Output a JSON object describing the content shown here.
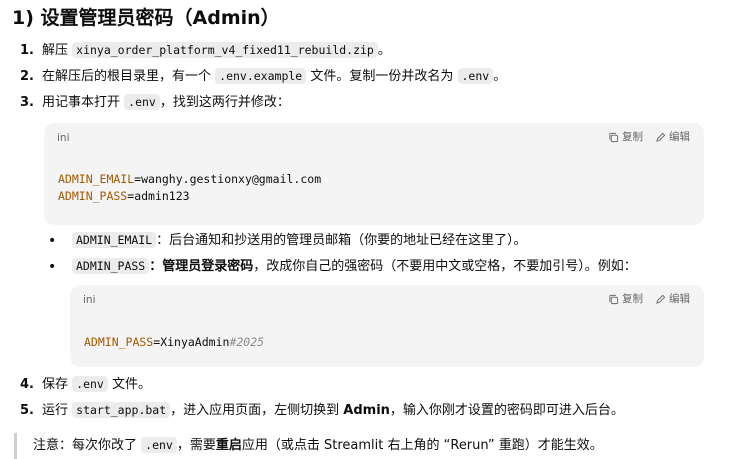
{
  "title": "1) 设置管理员密码（Admin）",
  "steps": [
    {
      "num": "1.",
      "pre": "解压 ",
      "code": "xinya_order_platform_v4_fixed11_rebuild.zip",
      "post": "。"
    },
    {
      "num": "2.",
      "pre": "在解压后的根目录里，有一个 ",
      "code": ".env.example",
      "mid": " 文件。复制一份并改名为 ",
      "code2": ".env",
      "post": "。"
    },
    {
      "num": "3.",
      "pre": "用记事本打开 ",
      "code": ".env",
      "post": "，找到这两行并修改："
    },
    {
      "num": "4.",
      "pre": "保存 ",
      "code": ".env",
      "post": " 文件。"
    },
    {
      "num": "5.",
      "pre": "运行 ",
      "code": "start_app.bat",
      "mid": "，进入应用页面，左侧切换到 ",
      "bold": "Admin",
      "post": "，输入你刚才设置的密码即可进入后台。"
    }
  ],
  "codeblock1": {
    "lang": "ini",
    "copy_label": "复制",
    "edit_label": "编辑",
    "line1_key": "ADMIN_EMAIL",
    "line1_eq": "=",
    "line1_val": "wanghy.gestionxy@gmail.com",
    "line2_key": "ADMIN_PASS",
    "line2_eq": "=",
    "line2_val": "admin123"
  },
  "bullets": [
    {
      "code": "ADMIN_EMAIL",
      "text": "：后台通知和抄送用的管理员邮箱（你要的地址已经在这里了）。"
    },
    {
      "code": "ADMIN_PASS",
      "bold": "：管理员登录密码",
      "text": "，改成你自己的强密码（不要用中文或空格，不要加引号）。例如："
    }
  ],
  "codeblock2": {
    "lang": "ini",
    "copy_label": "复制",
    "edit_label": "编辑",
    "key": "ADMIN_PASS",
    "eq": "=",
    "val": "XinyaAdmin",
    "comment": "#2025"
  },
  "note": {
    "pre": "注意：每次你改了 ",
    "code": ".env",
    "mid": "，需要",
    "bold": "重启",
    "post": "应用（或点击 Streamlit 右上角的 “Rerun” 重跑）才能生效。"
  }
}
